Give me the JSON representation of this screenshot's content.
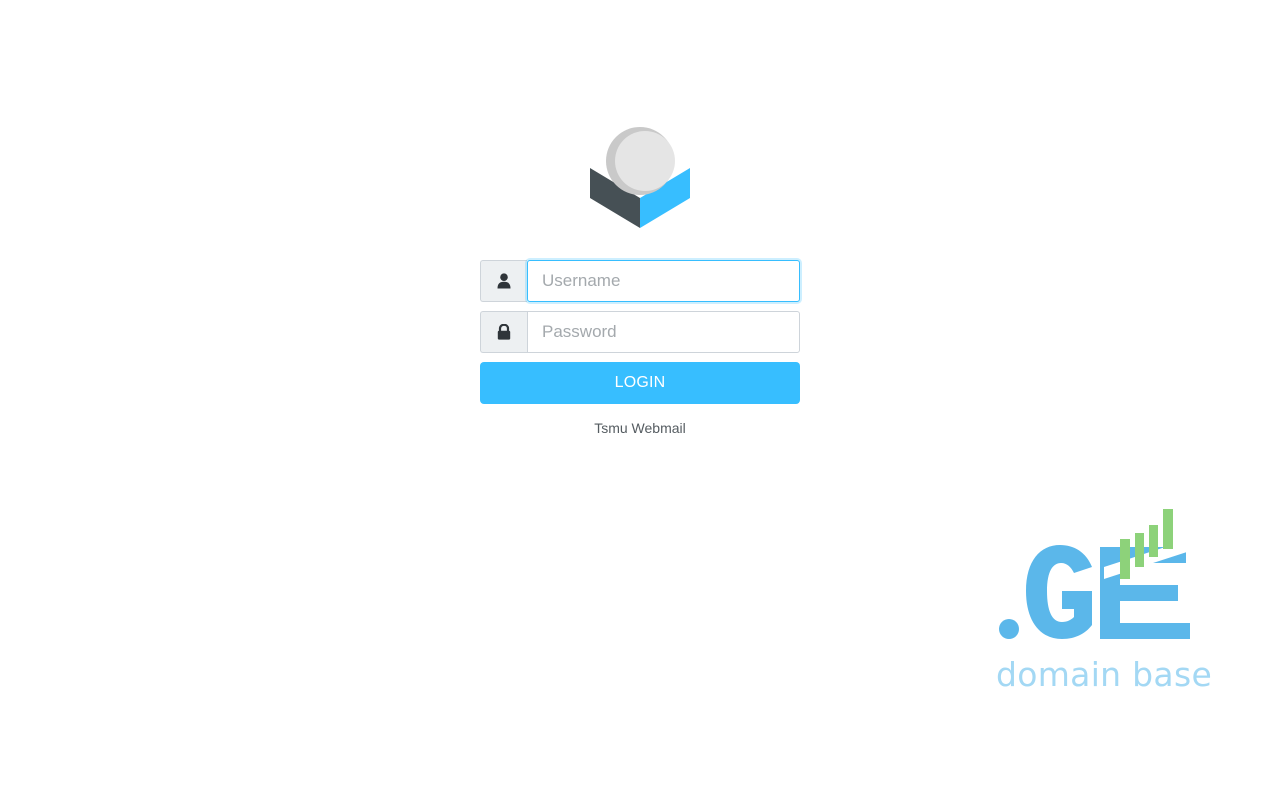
{
  "login": {
    "username_placeholder": "Username",
    "password_placeholder": "Password",
    "login_label": "LOGIN",
    "product_name": "Tsmu Webmail"
  },
  "icons": {
    "app_logo": "roundcube-logo-icon",
    "user": "user-icon",
    "lock": "lock-icon",
    "brand": "ge-domain-base-logo"
  },
  "sponsor": {
    "brand_letters": ".GE",
    "tagline": "domain base"
  },
  "colors": {
    "accent": "#37beff",
    "logo_dark": "#4b5257",
    "logo_sphere": "#e3e3e3",
    "ge_blue": "#5bb7ea",
    "ge_green": "#8dd27a",
    "tagline": "#a3d8f4"
  }
}
